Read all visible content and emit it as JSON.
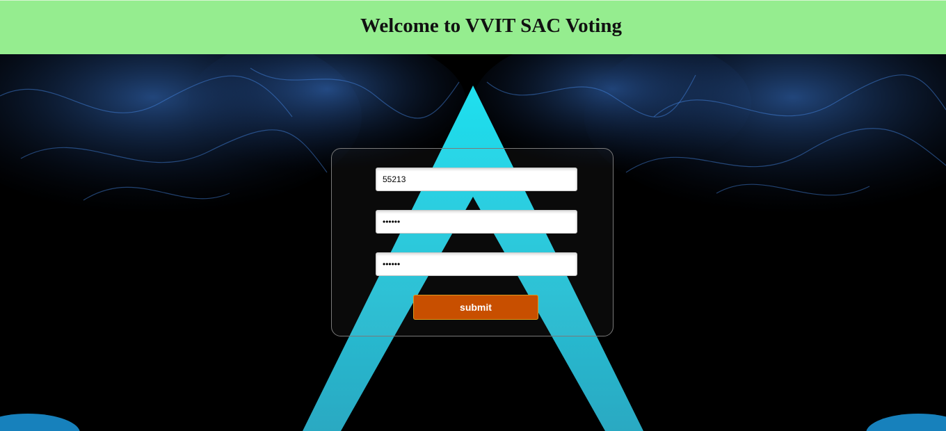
{
  "header": {
    "title": "Welcome to VVIT SAC Voting"
  },
  "form": {
    "username_value": "55213",
    "password_value": "123456",
    "confirm_password_value": "123456",
    "submit_label": "submit"
  },
  "colors": {
    "header_bg": "#95ed8f",
    "submit_bg": "#c84f00",
    "triangle": "#23c3d4",
    "smoke": "#3f7fe0"
  }
}
